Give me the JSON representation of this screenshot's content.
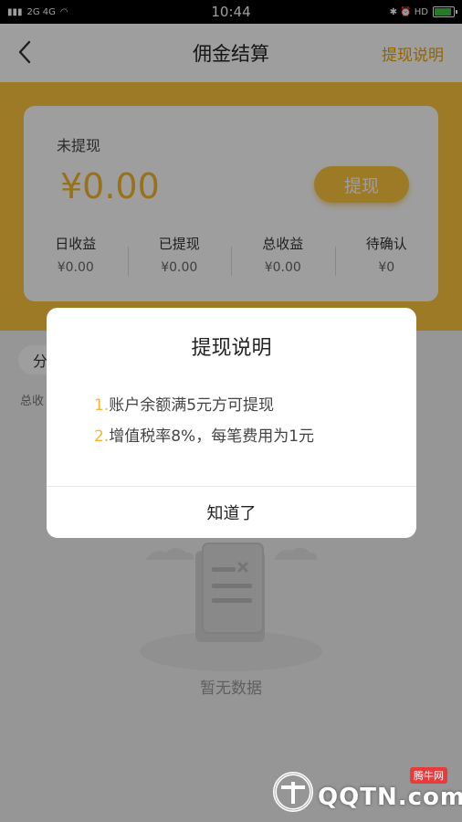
{
  "status_bar": {
    "time": "10:44",
    "left_indicators": "2G 4G",
    "right_indicators": "✱ ⏰ HD"
  },
  "header": {
    "title": "佣金结算",
    "right_link": "提现说明"
  },
  "card": {
    "label": "未提现",
    "amount": "¥0.00",
    "withdraw_button": "提现",
    "stats": [
      {
        "label": "日收益",
        "value": "¥0.00"
      },
      {
        "label": "已提现",
        "value": "¥0.00"
      },
      {
        "label": "总收益",
        "value": "¥0.00"
      },
      {
        "label": "待确认",
        "value": "¥0"
      }
    ]
  },
  "filter": {
    "chip_label": "分",
    "total_label": "总收"
  },
  "empty_state": {
    "text": "暂无数据"
  },
  "dialog": {
    "title": "提现说明",
    "items": [
      {
        "num": "1.",
        "text": "账户余额满5元方可提现"
      },
      {
        "num": "2.",
        "text": "增值税率8%，每笔费用为1元"
      }
    ],
    "ok_button": "知道了"
  },
  "watermark": {
    "brand": "QQTN.com",
    "tag": "腾牛网"
  },
  "colors": {
    "accent": "#fcc63e",
    "accent_text": "#f6b72c",
    "link": "#e9a400"
  }
}
